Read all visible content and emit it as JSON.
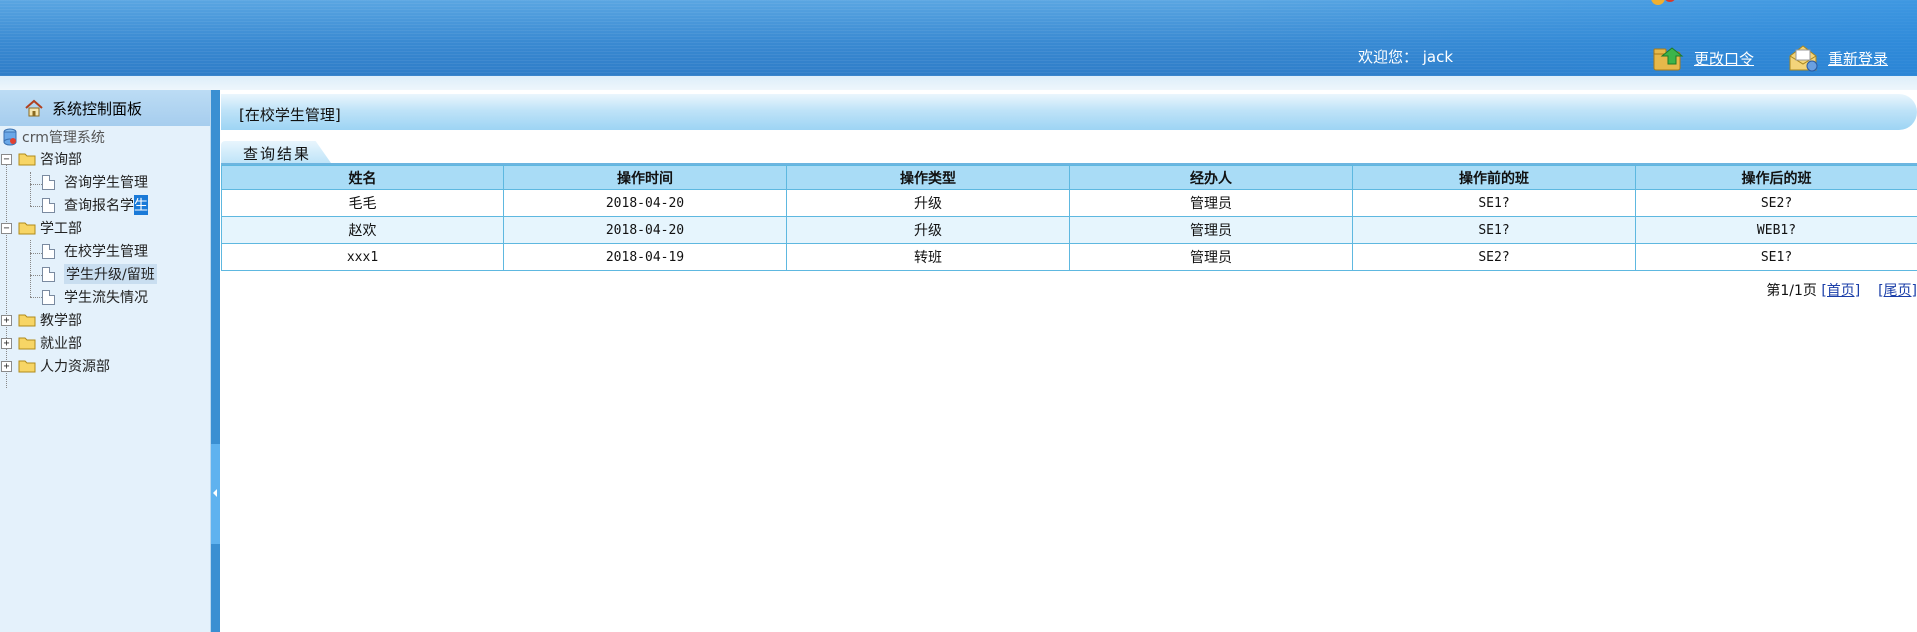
{
  "header": {
    "welcome": "欢迎您： jack",
    "change_password": "更改口令",
    "relogin": "重新登录"
  },
  "sidebar": {
    "panel_title": "系统控制面板",
    "root": "crm管理系统",
    "groups": [
      {
        "label": "咨询部",
        "expanded": true,
        "items": [
          {
            "label": "咨询学生管理"
          },
          {
            "label_a": "查询报名学",
            "label_b": "生"
          }
        ]
      },
      {
        "label": "学工部",
        "expanded": true,
        "items": [
          {
            "label": "在校学生管理"
          },
          {
            "label": "学生升级/留班"
          },
          {
            "label": "学生流失情况"
          }
        ]
      },
      {
        "label": "教学部",
        "expanded": false
      },
      {
        "label": "就业部",
        "expanded": false
      },
      {
        "label": "人力资源部",
        "expanded": false
      }
    ]
  },
  "main": {
    "title": "[在校学生管理]",
    "tab": "查询结果",
    "table": {
      "columns": [
        "姓名",
        "操作时间",
        "操作类型",
        "经办人",
        "操作前的班",
        "操作后的班"
      ],
      "rows": [
        [
          "毛毛",
          "2018-04-20",
          "升级",
          "管理员",
          "SE1?",
          "SE2?"
        ],
        [
          "赵欢",
          "2018-04-20",
          "升级",
          "管理员",
          "SE1?",
          "WEB1?"
        ],
        [
          "xxx1",
          "2018-04-19",
          "转班",
          "管理员",
          "SE2?",
          "SE1?"
        ]
      ]
    },
    "pager": {
      "info": "第1/1页",
      "first": "[首页]",
      "last": "[尾页]"
    }
  },
  "colors": {
    "header_blue": "#3a8ad2",
    "sidebar_bg": "#e4f1fb",
    "table_header": "#a9dcf6",
    "row_alt": "#e6f5fd",
    "link": "#1a3ea8"
  }
}
